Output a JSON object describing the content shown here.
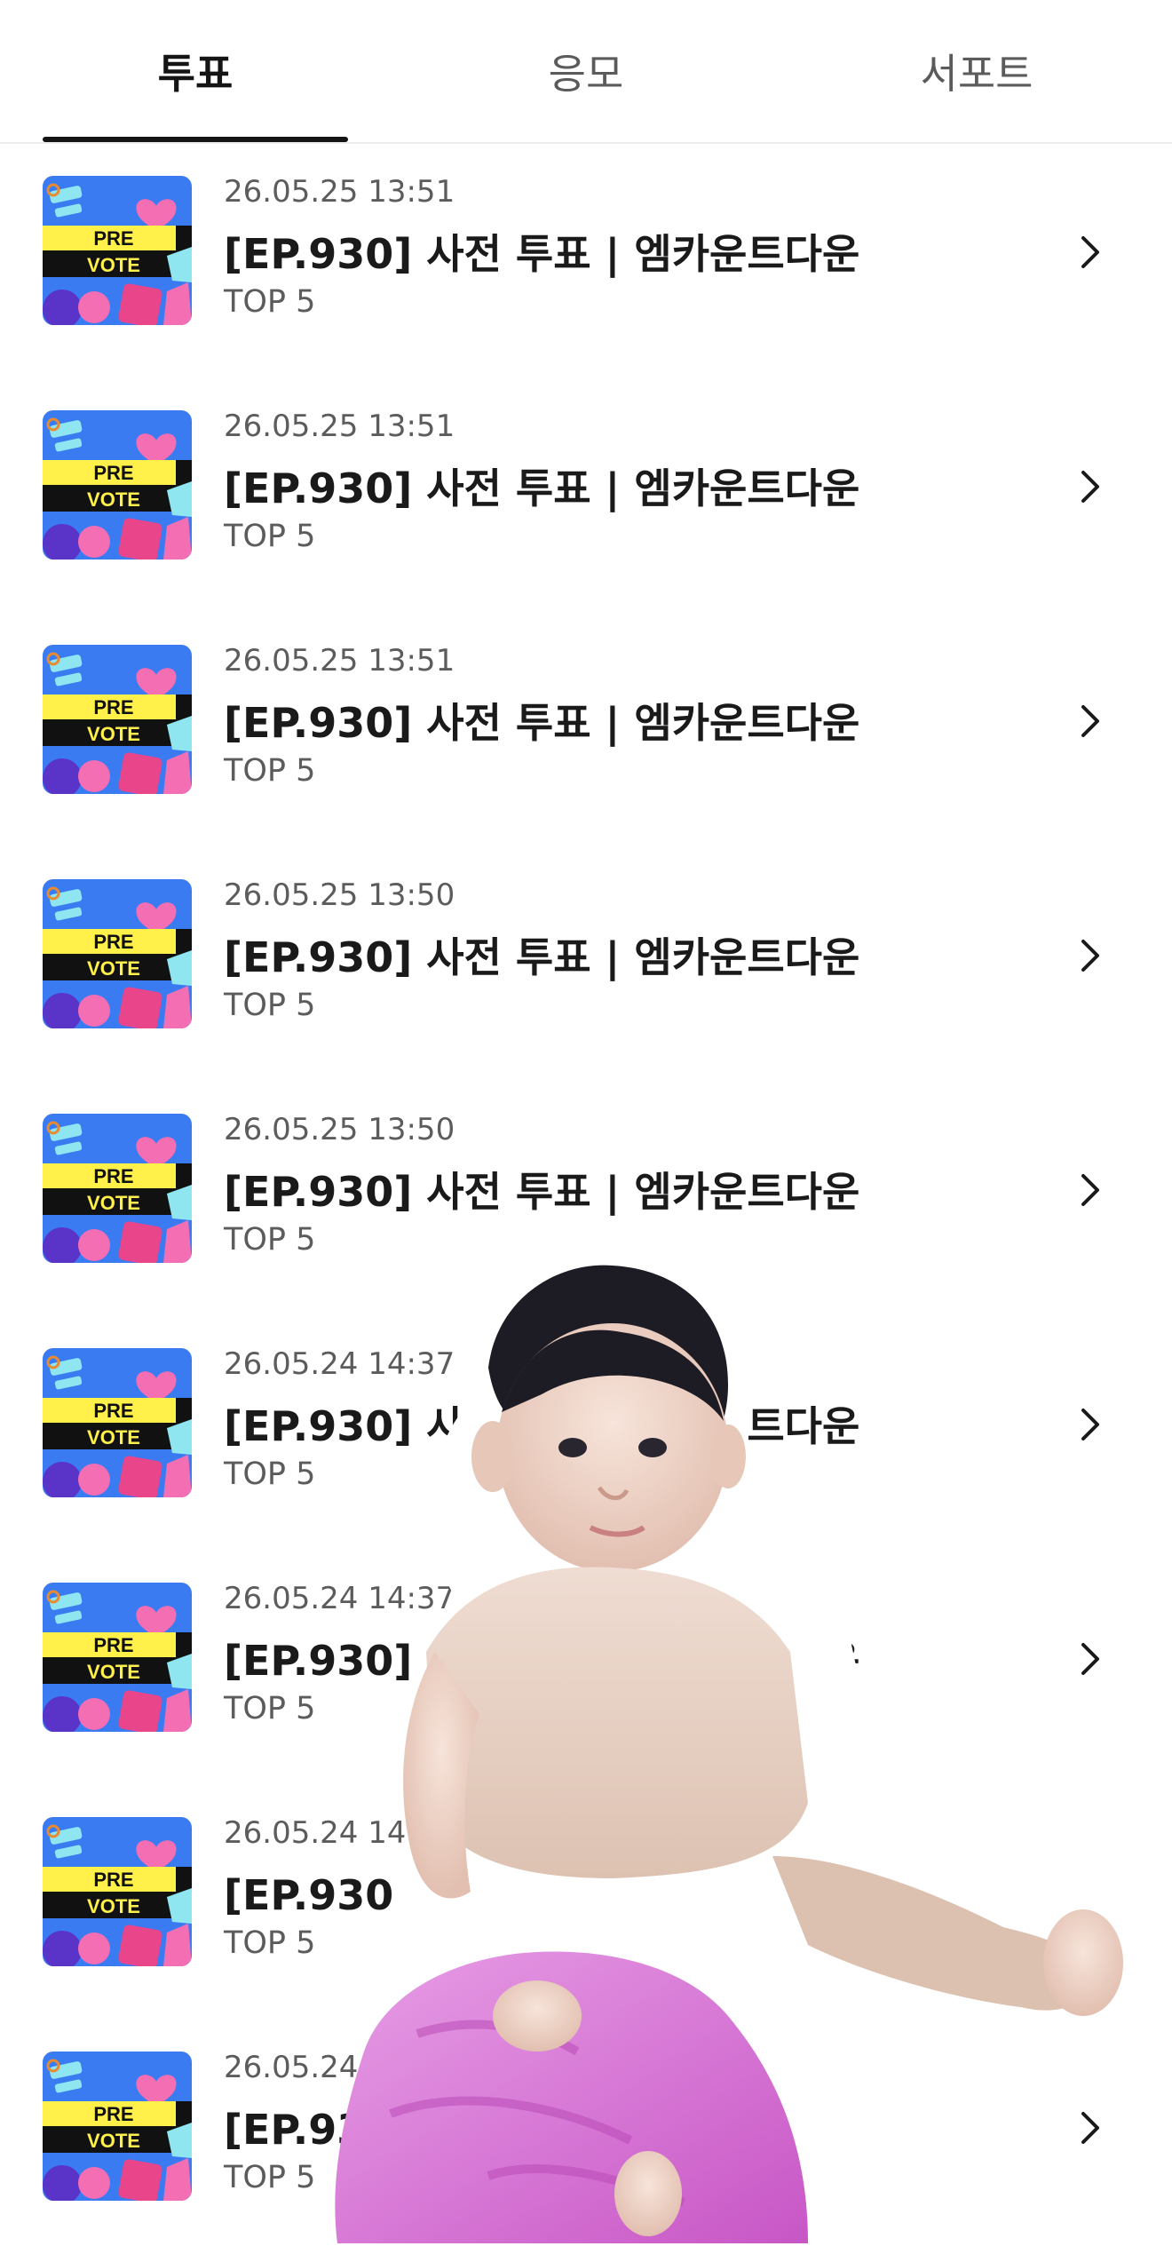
{
  "tabs": [
    {
      "label": "투표",
      "active": true
    },
    {
      "label": "응모",
      "active": false
    },
    {
      "label": "서포트",
      "active": false
    }
  ],
  "thumbnail": {
    "line1": "PRE",
    "line2": "VOTE",
    "colors": {
      "bg": "#3b7bf2",
      "band": "#fff04a",
      "dark": "#111111",
      "pink": "#f46eb4",
      "cyan": "#8fe6f0"
    }
  },
  "items": [
    {
      "date": "26.05.25 13:51",
      "title": "[EP.930] 사전 투표 | 엠카운트다운",
      "subtitle": "TOP 5"
    },
    {
      "date": "26.05.25 13:51",
      "title": "[EP.930] 사전 투표 | 엠카운트다운",
      "subtitle": "TOP 5"
    },
    {
      "date": "26.05.25 13:51",
      "title": "[EP.930] 사전 투표 | 엠카운트다운",
      "subtitle": "TOP 5"
    },
    {
      "date": "26.05.25 13:50",
      "title": "[EP.930] 사전 투표 | 엠카운트다운",
      "subtitle": "TOP 5"
    },
    {
      "date": "26.05.25 13:50",
      "title": "[EP.930] 사전 투표 | 엠카운트다운",
      "subtitle": "TOP 5"
    },
    {
      "date": "26.05.24 14:37",
      "title": "[EP.930] 사전 투표 | 엠카운트다운",
      "subtitle": "TOP 5"
    },
    {
      "date": "26.05.24 14:37",
      "title": "[EP.930] 사전 투표 | 엠카운트다운",
      "subtitle": "TOP 5"
    },
    {
      "date": "26.05.24 14:37",
      "title": "[EP.930] 사전 투표 | 엠카운트다운",
      "subtitle": "TOP 5"
    },
    {
      "date": "26.05.24 14:37",
      "title": "[EP.930] 사전 투표 | 엠카운트다운",
      "subtitle": "TOP 5"
    }
  ],
  "icons": {
    "row_action": "chevron-right-icon",
    "overlay": "baby-photo-sticker"
  }
}
